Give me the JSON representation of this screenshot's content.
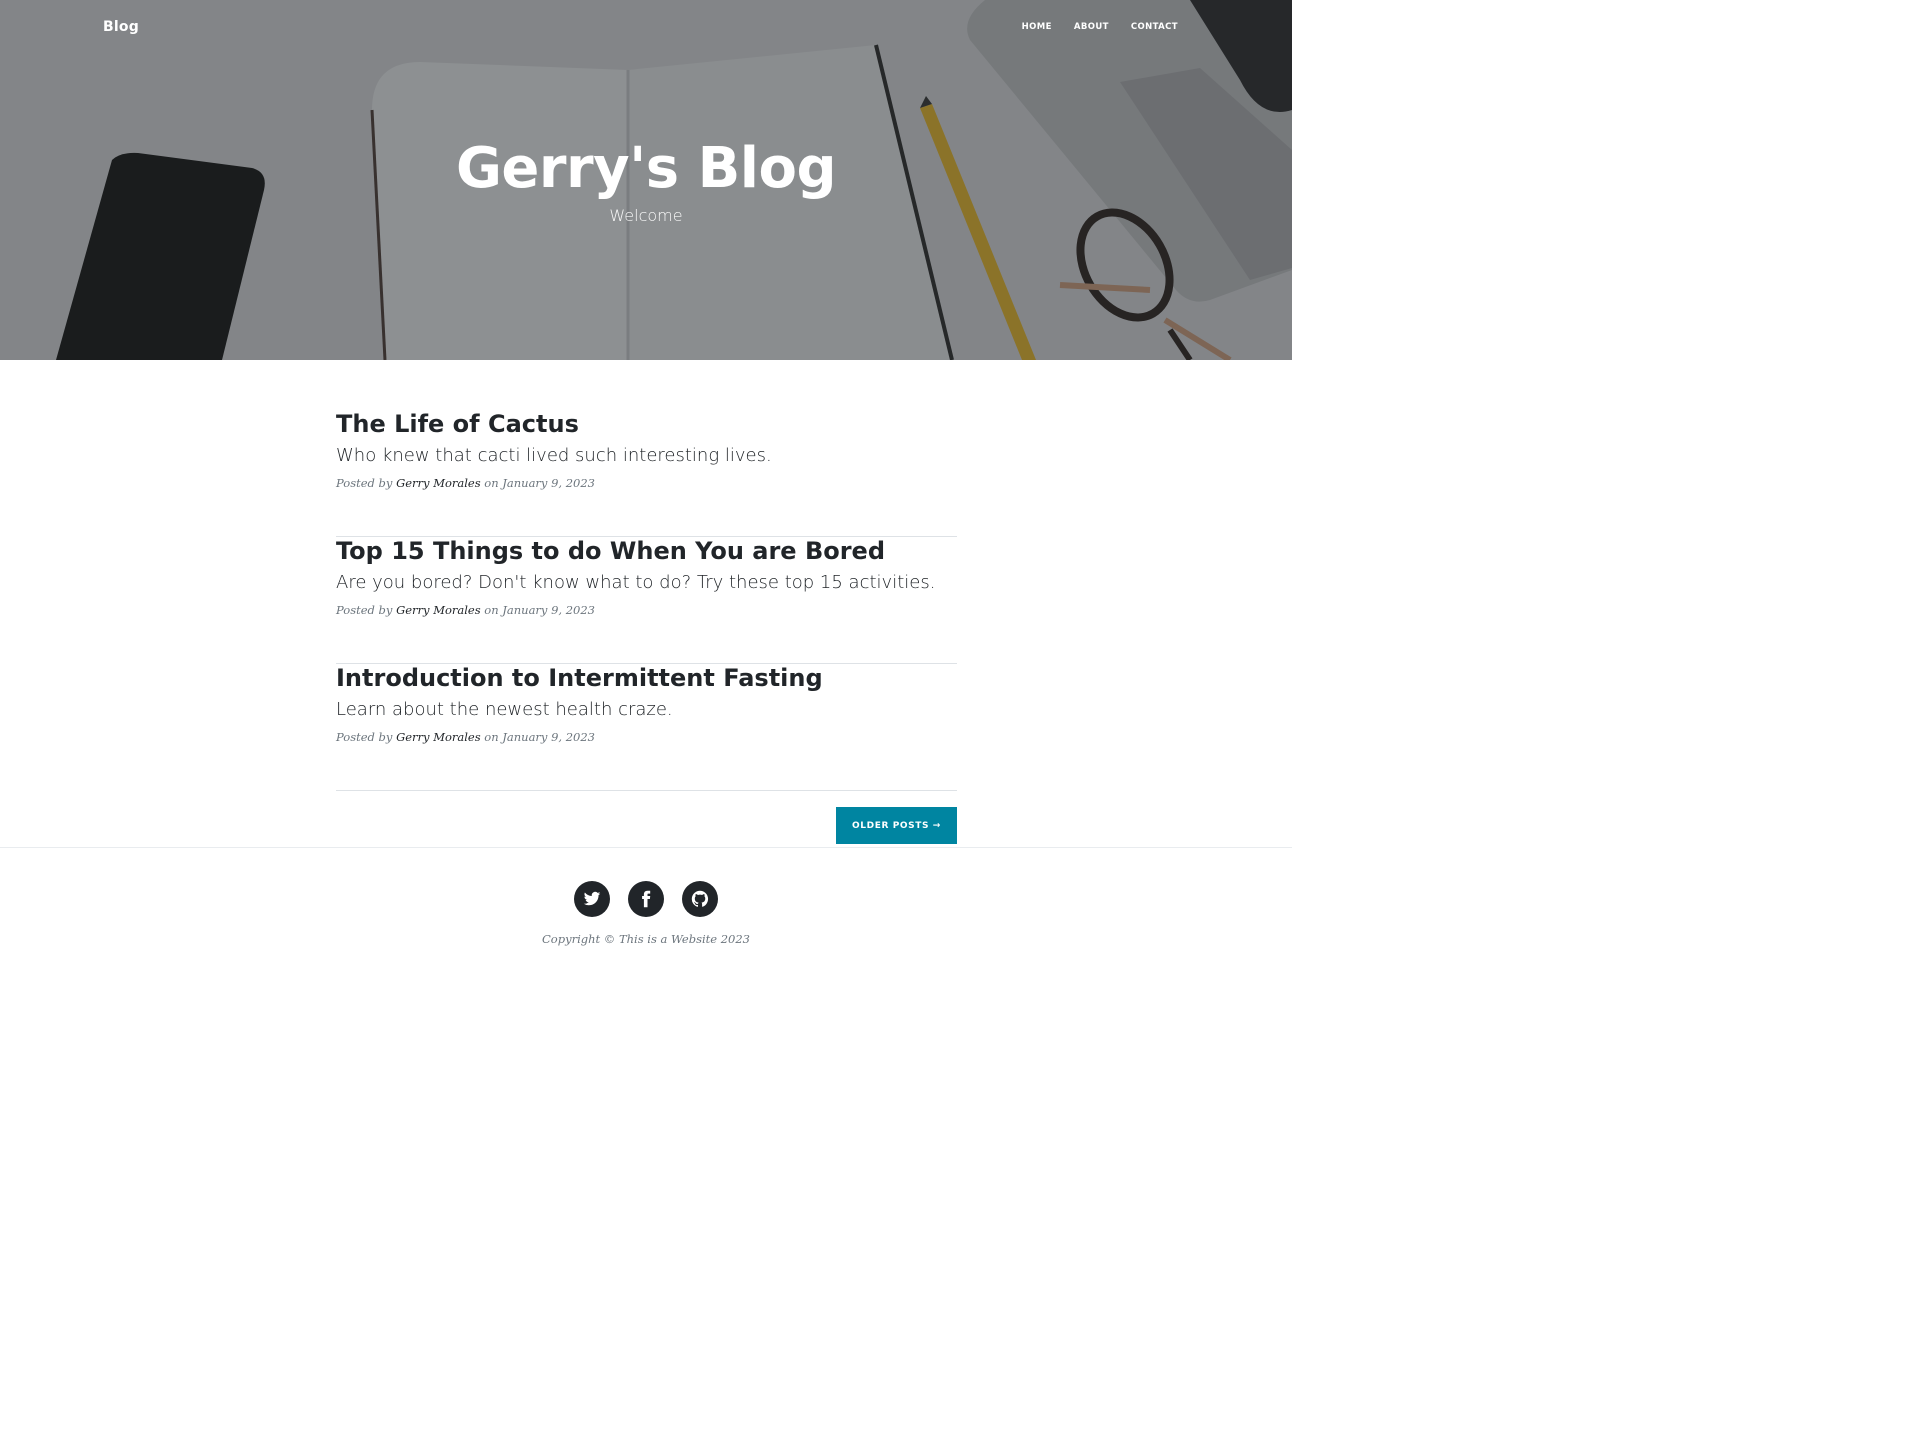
{
  "navbar": {
    "brand": "Blog",
    "links": [
      "HOME",
      "ABOUT",
      "CONTACT"
    ]
  },
  "masthead": {
    "title": "Gerry's Blog",
    "subtitle": "Welcome"
  },
  "posts": [
    {
      "title": "The Life of Cactus",
      "subtitle": "Who knew that cacti lived such interesting lives.",
      "meta_prefix": "Posted by",
      "author": "Gerry Morales",
      "meta_on": "on",
      "date": "January 9, 2023"
    },
    {
      "title": "Top 15 Things to do When You are Bored",
      "subtitle": "Are you bored? Don't know what to do? Try these top 15 activities.",
      "meta_prefix": "Posted by",
      "author": "Gerry Morales",
      "meta_on": "on",
      "date": "January 9, 2023"
    },
    {
      "title": "Introduction to Intermittent Fasting",
      "subtitle": "Learn about the newest health craze.",
      "meta_prefix": "Posted by",
      "author": "Gerry Morales",
      "meta_on": "on",
      "date": "January 9, 2023"
    }
  ],
  "pager": {
    "older_label": "OLDER POSTS →"
  },
  "footer": {
    "social": [
      "twitter-icon",
      "facebook-icon",
      "github-icon"
    ],
    "copyright": "Copyright © This is a Website 2023"
  },
  "colors": {
    "accent": "#0085a1",
    "text": "#212529",
    "muted": "#6c757d"
  }
}
